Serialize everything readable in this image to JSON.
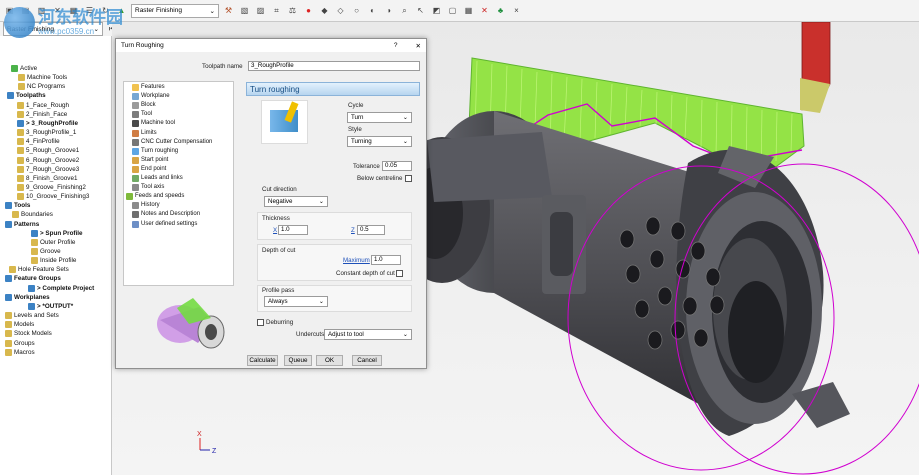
{
  "toolbar": {
    "strategy_label": "Raster Finishing",
    "strategy_combo_text": "Raster Finishing"
  },
  "toolbar2": {
    "playback_text": "Raster Finishing"
  },
  "watermark": {
    "site_name": "河东软件园",
    "site_url": "www.pc0359.cn"
  },
  "explorer": {
    "items": [
      {
        "label": "Active",
        "bold": false
      },
      {
        "label": "Machine Tools",
        "bold": false
      },
      {
        "label": "NC Programs",
        "bold": false
      },
      {
        "label": "Toolpaths",
        "bold": true
      },
      {
        "label": "1_Face_Rough",
        "bold": false
      },
      {
        "label": "2_Finish_Face",
        "bold": false
      },
      {
        "label": "> 3_RoughProfile",
        "bold": true
      },
      {
        "label": "3_RoughProfile_1",
        "bold": false
      },
      {
        "label": "4_FinProfile",
        "bold": false
      },
      {
        "label": "5_Rough_Groove1",
        "bold": false
      },
      {
        "label": "6_Rough_Groove2",
        "bold": false
      },
      {
        "label": "7_Rough_Groove3",
        "bold": false
      },
      {
        "label": "8_Finish_Groove1",
        "bold": false
      },
      {
        "label": "9_Groove_Finishing2",
        "bold": false
      },
      {
        "label": "10_Groove_Finishing3",
        "bold": false
      },
      {
        "label": "Tools",
        "bold": true
      },
      {
        "label": "Boundaries",
        "bold": false
      },
      {
        "label": "Patterns",
        "bold": true
      },
      {
        "label": "> Spun Profile",
        "bold": true
      },
      {
        "label": "Outer Profile",
        "bold": false
      },
      {
        "label": "Groove",
        "bold": false
      },
      {
        "label": "Inside Profile",
        "bold": false
      },
      {
        "label": "Hole Feature Sets",
        "bold": false
      },
      {
        "label": "Feature Groups",
        "bold": true
      },
      {
        "label": "> Complete Project",
        "bold": true
      },
      {
        "label": "Workplanes",
        "bold": true
      },
      {
        "label": "> *OUTPUT*",
        "bold": true
      },
      {
        "label": "Levels and Sets",
        "bold": false
      },
      {
        "label": "Models",
        "bold": false
      },
      {
        "label": "Stock Models",
        "bold": false
      },
      {
        "label": "Groups",
        "bold": false
      },
      {
        "label": "Macros",
        "bold": false
      }
    ]
  },
  "dialog": {
    "title": "Turn Roughing",
    "toolpath_name_label": "Toolpath name",
    "toolpath_name_value": "3_RoughProfile",
    "panel_header": "Turn roughing",
    "nav": [
      "Features",
      "Workplane",
      "Block",
      "Tool",
      "Machine tool",
      "Limits",
      "CNC Cutter Compensation",
      "Turn roughing",
      "Start point",
      "End point",
      "Leads and links",
      "Tool axis",
      "Feeds and speeds",
      "History",
      "Notes and Description",
      "User defined settings"
    ],
    "cycle_label": "Cycle",
    "cycle_value": "Turn",
    "style_label": "Style",
    "style_value": "Turning",
    "tolerance_label": "Tolerance",
    "tolerance_value": "0.05",
    "below_centreline_label": "Below centreline",
    "cut_direction_label": "Cut direction",
    "cut_direction_value": "Negative",
    "thickness_label": "Thickness",
    "x_label": "X",
    "x_value": "1.0",
    "z_label": "Z",
    "z_value": "0.5",
    "depth_of_cut_label": "Depth of cut",
    "maximum_label": "Maximum",
    "maximum_value": "1.0",
    "constant_depth_label": "Constant depth of cut",
    "profile_pass_label": "Profile pass",
    "profile_pass_value": "Always",
    "deburring_label": "Deburring",
    "undercuts_label": "Undercuts",
    "undercuts_value": "Adjust to tool",
    "buttons": {
      "calculate": "Calculate",
      "queue": "Queue",
      "ok": "OK",
      "cancel": "Cancel"
    },
    "help_glyph": "?",
    "close_glyph": "✕"
  },
  "axis": {
    "x": "X",
    "z": "Z"
  },
  "colors": {
    "accent": "#2e8bd2",
    "part": "#4e4e53",
    "toolpath_green": "#7ddc2e",
    "magenta": "#d000d0",
    "tool_red": "#c9302c"
  }
}
